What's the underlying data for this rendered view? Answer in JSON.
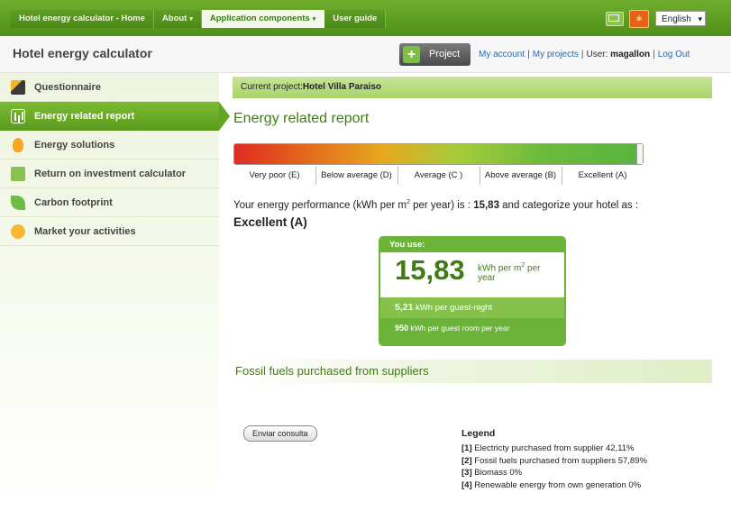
{
  "nav": {
    "items": [
      {
        "label": "Hotel energy calculator - Home",
        "caret": ""
      },
      {
        "label": "About",
        "caret": "▾"
      },
      {
        "label": "Application components",
        "caret": "▾"
      },
      {
        "label": "User guide",
        "caret": ""
      }
    ],
    "language": "English"
  },
  "header": {
    "app_title": "Hotel energy calculator",
    "project_button": "Project",
    "my_account": "My account",
    "my_projects": "My projects",
    "user_prefix": "User:",
    "user_name": "magallon",
    "logout": "Log Out",
    "separator": "|"
  },
  "sidebar": {
    "items": [
      {
        "label": "Questionnaire",
        "icon": "pencil-icon"
      },
      {
        "label": "Energy related report",
        "icon": "bar-chart-icon"
      },
      {
        "label": "Energy solutions",
        "icon": "lightbulb-icon"
      },
      {
        "label": "Return on investment calculator",
        "icon": "calculator-icon"
      },
      {
        "label": "Carbon footprint",
        "icon": "leaf-icon"
      },
      {
        "label": "Market your activities",
        "icon": "sun-icon"
      }
    ]
  },
  "main": {
    "current_project_label": "Current project:",
    "current_project_name": "Hotel Villa Paraiso",
    "page_title": "Energy related report",
    "scale_labels": [
      "Very poor (E)",
      "Below average (D)",
      "Average (C )",
      "Above average (B)",
      "Excellent (A)"
    ],
    "performance_text_a": "Your energy performance (kWh per m",
    "performance_sup": "2",
    "performance_text_b": " per year) is : ",
    "performance_value": "15,83",
    "performance_text_c": " and categorize your hotel as :",
    "performance_category": "Excellent (A)",
    "use_box": {
      "header": "You use:",
      "big_value": "15,83",
      "unit_a": "kWh per m",
      "unit_sup": "2",
      "unit_b": " per year",
      "guest_night_value": "5,21",
      "guest_night_text": " kWh per guest-night",
      "room_year_value": "950",
      "room_year_text": " kWh per guest room per year"
    },
    "fossil_title": "Fossil fuels purchased from suppliers",
    "enviar_button": "Enviar consulta",
    "legend": {
      "title": "Legend",
      "items": [
        {
          "num": "[1]",
          "text": " Electricty purchased from supplier 42,11%"
        },
        {
          "num": "[2]",
          "text": " Fossil fuels purchased from suppliers 57,89%"
        },
        {
          "num": "[3]",
          "text": " Biomass 0%"
        },
        {
          "num": "[4]",
          "text": " Renewable energy from own generation 0%"
        }
      ]
    }
  },
  "colors": {
    "brand_green": "#6cb33a",
    "dark_green": "#3f7d14",
    "link_blue": "#2b6cb0"
  }
}
